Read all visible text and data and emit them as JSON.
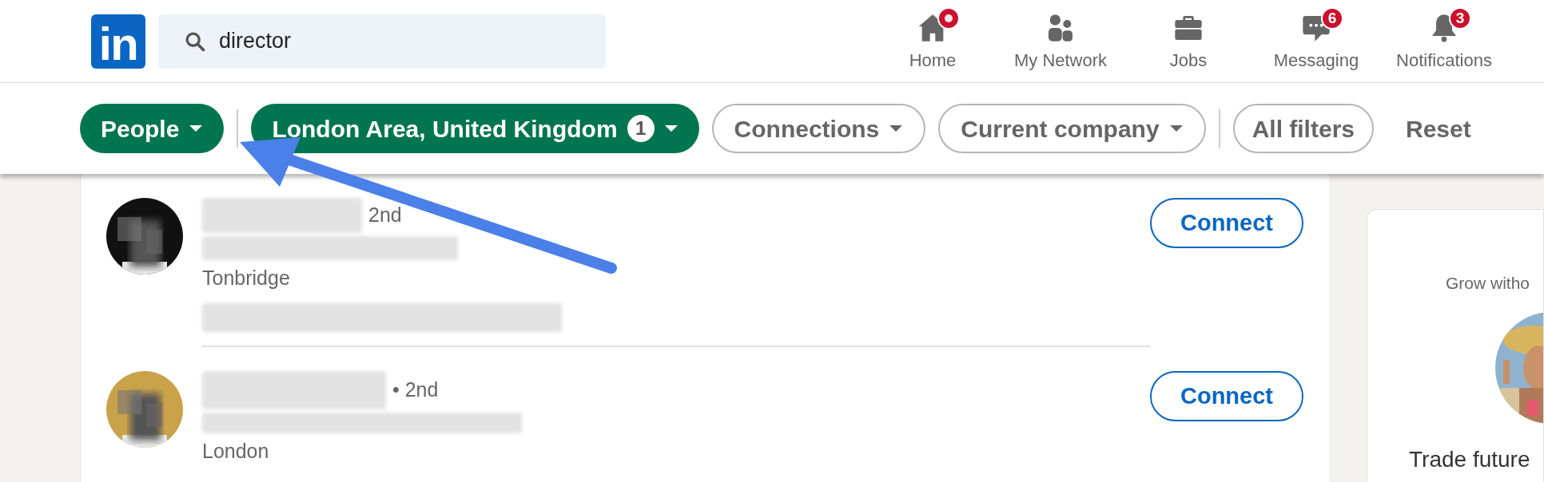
{
  "logo": {
    "text": "in"
  },
  "search": {
    "value": "director"
  },
  "nav": [
    {
      "label": "Home",
      "new_dot": true
    },
    {
      "label": "My Network",
      "new_dot": false
    },
    {
      "label": "Jobs",
      "new_dot": false
    },
    {
      "label": "Messaging",
      "new_dot": false,
      "badge": "6"
    },
    {
      "label": "Notifications",
      "new_dot": false,
      "badge": "3"
    }
  ],
  "filters": [
    {
      "label": "People",
      "selected": true
    },
    {
      "label": "London Area, United Kingdom",
      "selected": true,
      "count": "1"
    },
    {
      "label": "Connections",
      "selected": false
    },
    {
      "label": "Current company",
      "selected": false
    }
  ],
  "all_filters": "All filters",
  "reset": "Reset",
  "results": [
    {
      "degree": "2nd",
      "location": "Tonbridge",
      "action": "Connect"
    },
    {
      "degree": "• 2nd",
      "location": "London",
      "action": "Connect"
    }
  ],
  "sidebar": {
    "intro": "Grow witho",
    "headline": "Trade future"
  }
}
